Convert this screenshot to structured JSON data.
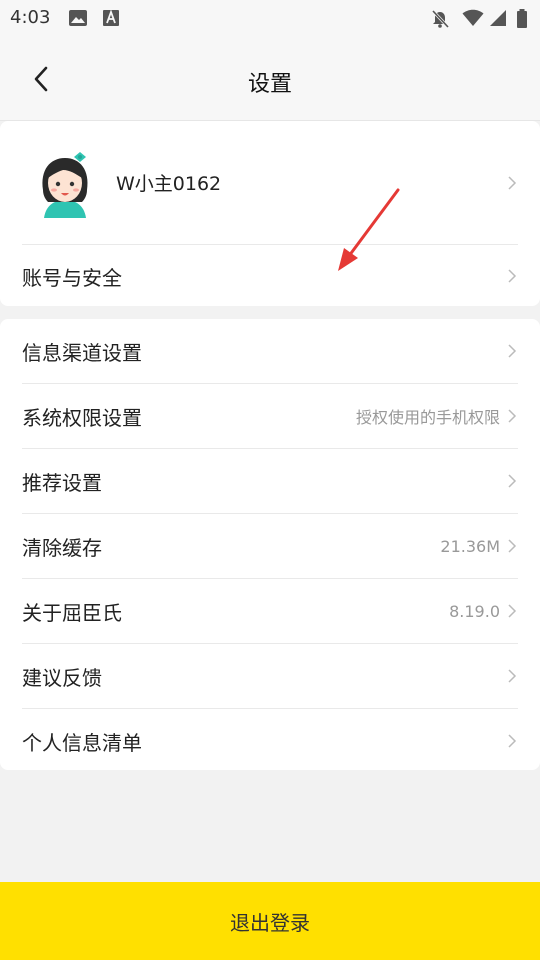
{
  "status_bar": {
    "time": "4:03",
    "icons": [
      "image-icon",
      "a-badge-icon",
      "bell-off-icon",
      "wifi-icon",
      "cell-signal-icon",
      "battery-icon"
    ]
  },
  "header": {
    "title": "设置",
    "back_icon": "chevron-left-icon"
  },
  "profile": {
    "username": "W小主0162",
    "avatar": "girl-avatar"
  },
  "account_section": {
    "items": [
      {
        "label": "账号与安全",
        "value": ""
      }
    ]
  },
  "settings_section": {
    "items": [
      {
        "label": "信息渠道设置",
        "value": ""
      },
      {
        "label": "系统权限设置",
        "value": "授权使用的手机权限"
      },
      {
        "label": "推荐设置",
        "value": ""
      },
      {
        "label": "清除缓存",
        "value": "21.36M"
      },
      {
        "label": "关于屈臣氏",
        "value": "8.19.0"
      },
      {
        "label": "建议反馈",
        "value": ""
      },
      {
        "label": "个人信息清单",
        "value": ""
      }
    ]
  },
  "logout": {
    "label": "退出登录"
  },
  "colors": {
    "accent_yellow": "#ffe000",
    "annotation_red": "#e53935",
    "background": "#f2f2f2"
  }
}
